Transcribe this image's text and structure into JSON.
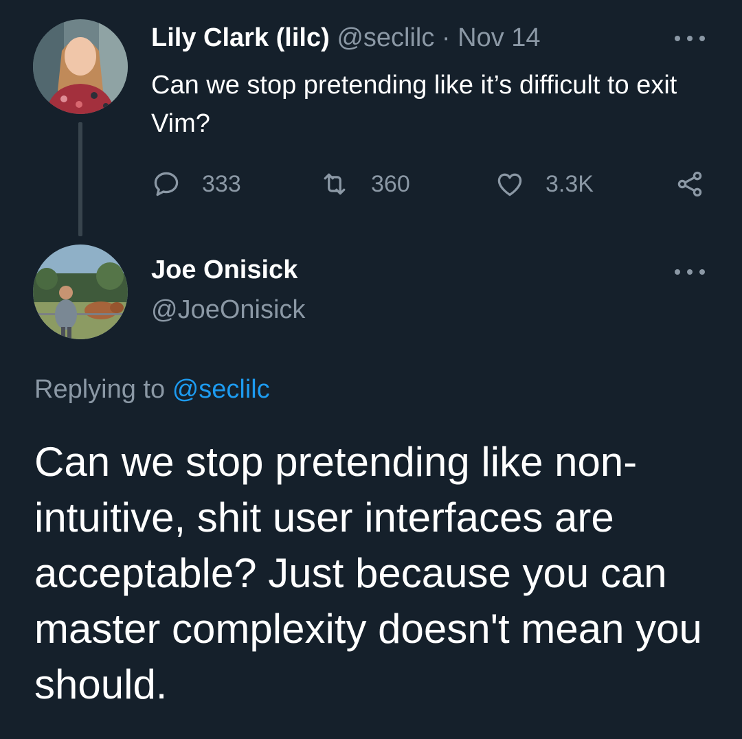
{
  "tweet": {
    "author_name": "Lily Clark (lilc)",
    "handle": "@seclilc",
    "separator": "·",
    "date": "Nov 14",
    "text": "Can we stop pretending like it’s difficult to exit Vim?",
    "reply_count": "333",
    "retweet_count": "360",
    "like_count": "3.3K",
    "icons": [
      "more-icon",
      "reply-icon",
      "retweet-icon",
      "like-icon",
      "share-icon"
    ]
  },
  "reply": {
    "author_name": "Joe Onisick",
    "handle": "@JoeOnisick",
    "replying_prefix": "Replying to",
    "replying_to": "@seclilc",
    "text": "Can we stop pretending like non-intuitive, shit user interfaces are acceptable? Just because you can master complexity doesn't mean you should."
  },
  "colors": {
    "background": "#15202b",
    "text": "#ffffff",
    "muted": "#8b98a5",
    "link": "#1d9bf0"
  }
}
